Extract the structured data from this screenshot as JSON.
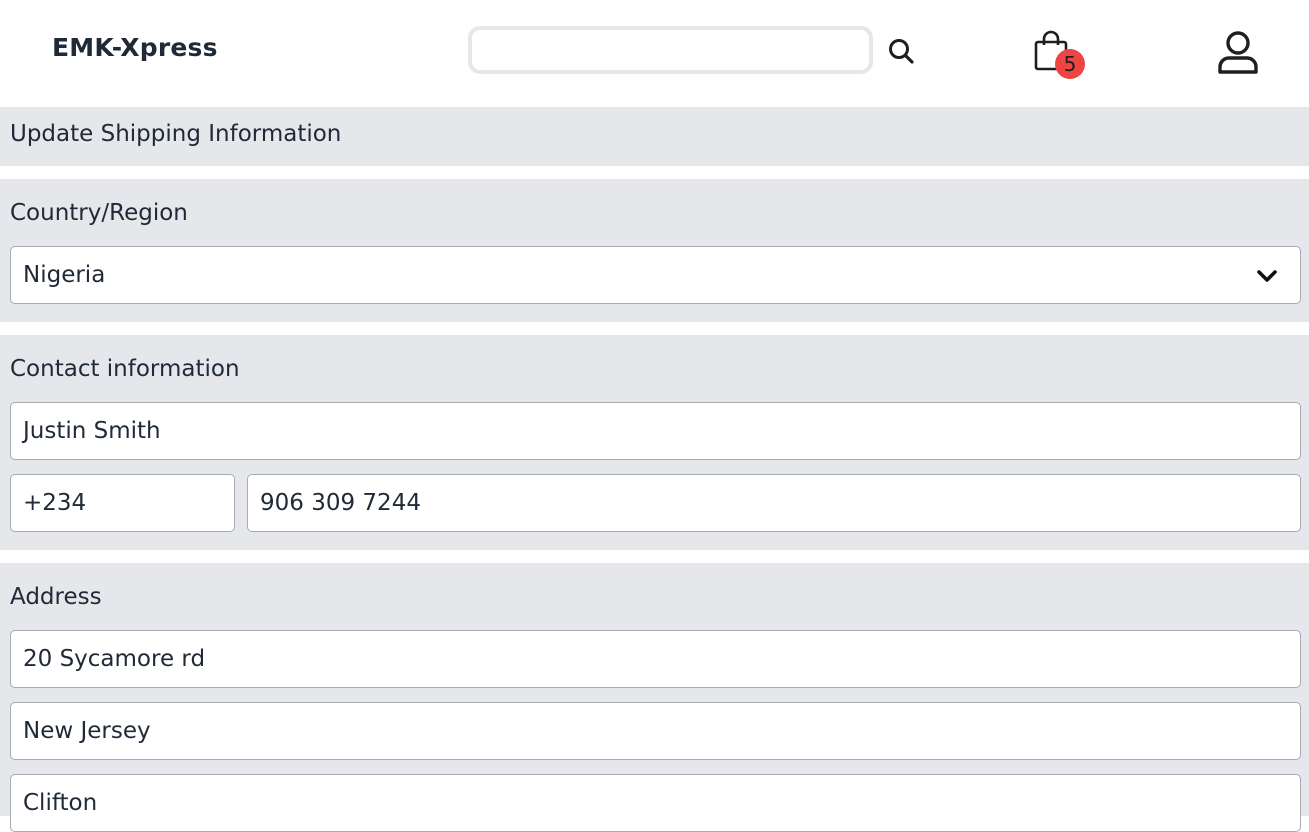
{
  "header": {
    "brand": "EMK-Xpress",
    "search": {
      "value": "",
      "placeholder": ""
    },
    "cart": {
      "count": "5"
    }
  },
  "page": {
    "title": "Update Shipping Information"
  },
  "country_section": {
    "label": "Country/Region",
    "selected": "Nigeria"
  },
  "contact_section": {
    "label": "Contact information",
    "name": "Justin Smith",
    "dial_code": "+234",
    "phone": "906 309 7244"
  },
  "address_section": {
    "label": "Address",
    "street": "20 Sycamore rd",
    "state": "New Jersey",
    "city": "Clifton"
  },
  "colors": {
    "panel_bg": "#e5e7eb",
    "badge": "#ef4444",
    "text": "#1f2937"
  },
  "icons": [
    "search-icon",
    "shopping-bag-icon",
    "user-icon",
    "chevron-down-icon"
  ]
}
